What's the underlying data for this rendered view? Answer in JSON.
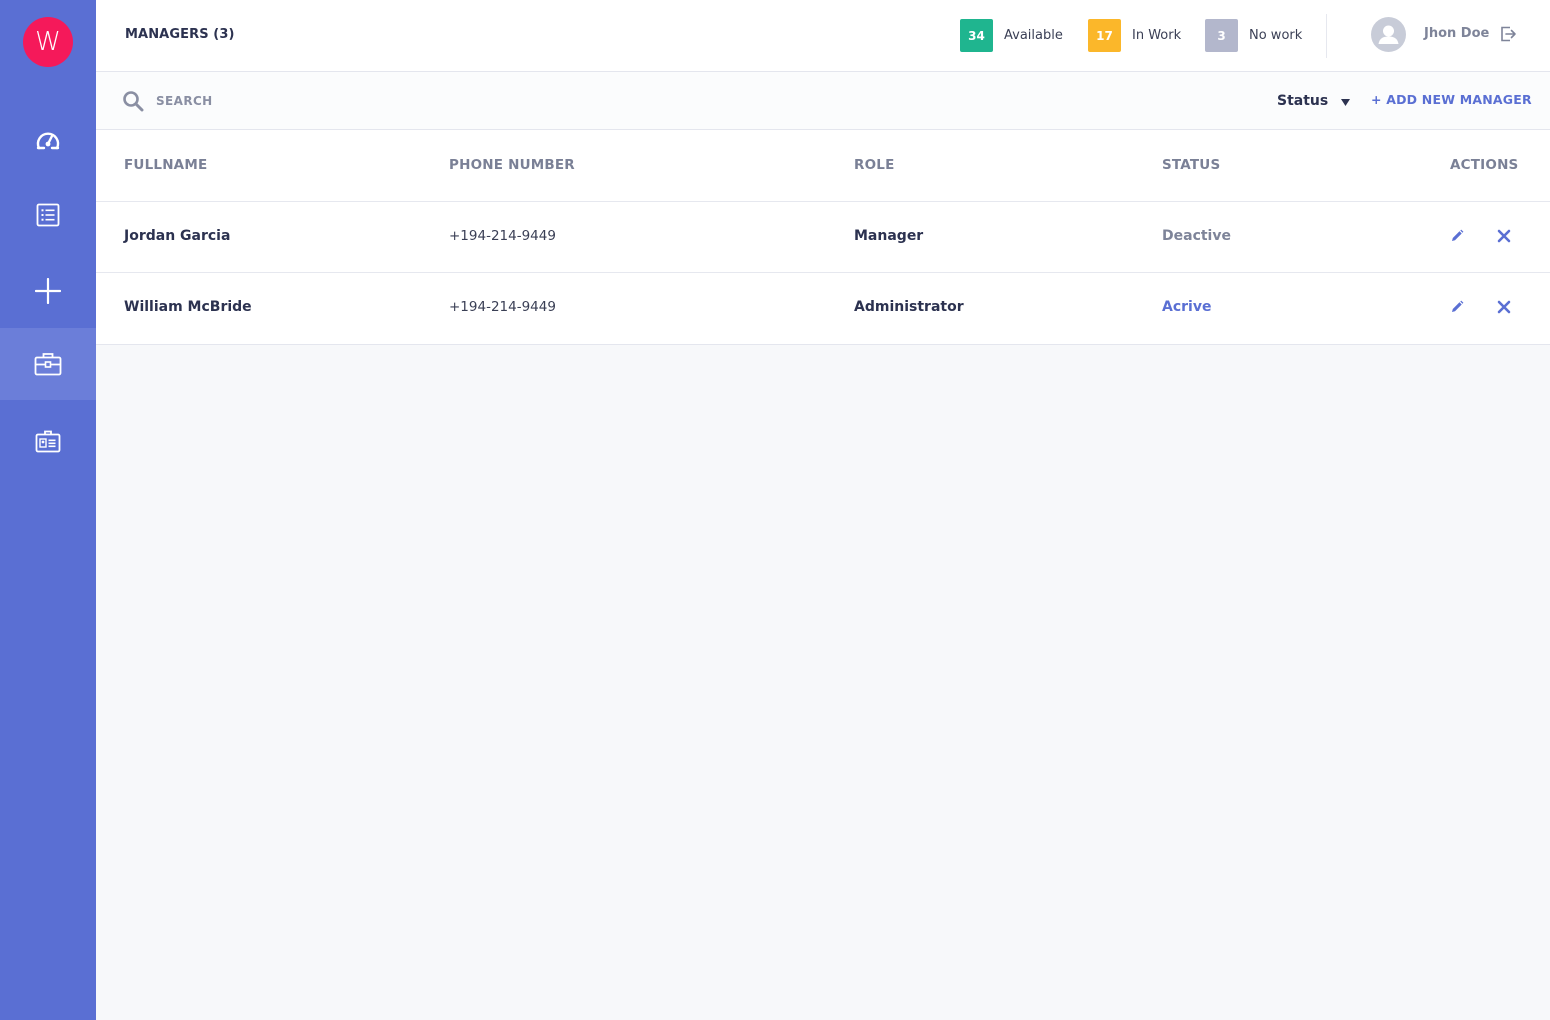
{
  "app": {
    "logo_letter": "W",
    "colors": {
      "sidebar": "#5a6fd3",
      "logo": "#f5195a",
      "accent": "#5a6fd3",
      "available": "#1fb58f",
      "in_work": "#fbb72a",
      "no_work": "#b3b7cc"
    }
  },
  "sidebar": {
    "items": [
      {
        "icon": "dashboard-icon",
        "active": false
      },
      {
        "icon": "list-icon",
        "active": false
      },
      {
        "icon": "plus-icon",
        "active": false
      },
      {
        "icon": "briefcase-icon",
        "active": true
      },
      {
        "icon": "id-card-icon",
        "active": false
      }
    ]
  },
  "header": {
    "title": "MANAGERS (3)",
    "stats": [
      {
        "count": "34",
        "label": "Available"
      },
      {
        "count": "17",
        "label": "In Work"
      },
      {
        "count": "3",
        "label": "No work"
      }
    ],
    "user": {
      "name": "Jhon Doe",
      "avatar_icon": "user-avatar-icon",
      "logout_icon": "logout-icon"
    }
  },
  "toolbar": {
    "search_placeholder": "SEARCH",
    "status_filter_label": "Status",
    "add_button_label": "+ ADD NEW MANAGER"
  },
  "table": {
    "columns": [
      "FULLNAME",
      "PHONE NUMBER",
      "ROLE",
      "STATUS",
      "ACTIONS"
    ],
    "rows": [
      {
        "fullname": "Jordan Garcia",
        "phone": "+194-214-9449",
        "role": "Manager",
        "status": "Deactive"
      },
      {
        "fullname": "William McBride",
        "phone": "+194-214-9449",
        "role": "Administrator",
        "status": "Acrive"
      }
    ]
  }
}
